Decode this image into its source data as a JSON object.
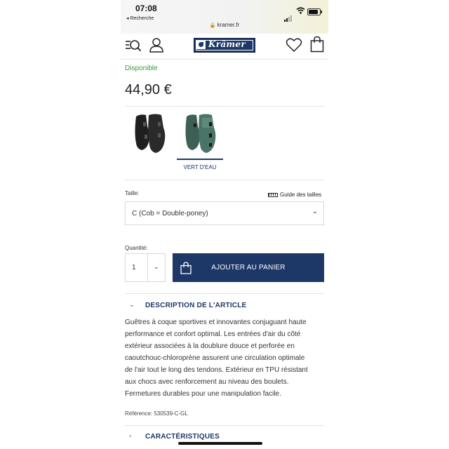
{
  "status_bar": {
    "time": "07:08",
    "back_label": "◂ Recherche",
    "url": "kramer.fr"
  },
  "header": {
    "logo_text": "Krämer",
    "icons": [
      "menu-search-icon",
      "user-icon",
      "heart-icon",
      "bag-icon"
    ]
  },
  "product": {
    "availability": "Disponible",
    "price": "44,90 €",
    "colors": [
      {
        "name": "",
        "selected": false,
        "color": "#1f1f1f"
      },
      {
        "name": "VERT D'EAU",
        "selected": true,
        "color": "#4b7468"
      }
    ]
  },
  "size": {
    "label": "Taille:",
    "guide_label": "Guide des tailles",
    "selected": "C (Cob = Double-poney)"
  },
  "quantity": {
    "label": "Quantité:",
    "value": "1"
  },
  "cart_button": {
    "label": "AJOUTER AU PANIER"
  },
  "description": {
    "title": "DESCRIPTION DE L'ARTICLE",
    "lines": [
      "Guêtres à coque sportives et innovantes conjuguant haute",
      "performance et confort optimal. Les entrées d'air du côté",
      "extérieur associées à la doublure douce et perforée en",
      "caoutchouc-chloroprène assurent une circulation optimale",
      "de l'air tout le long des tendons. Extérieur en TPU résistant",
      "aux chocs avec renforcement au niveau des boulets.",
      "Fermetures durables pour une manipulation facile."
    ],
    "reference": "Référence: 530539-C-GL"
  },
  "characteristics": {
    "title": "CARACTÉRISTIQUES"
  },
  "colors": {
    "brand": "#1d3766",
    "available": "#3a9b3a"
  }
}
